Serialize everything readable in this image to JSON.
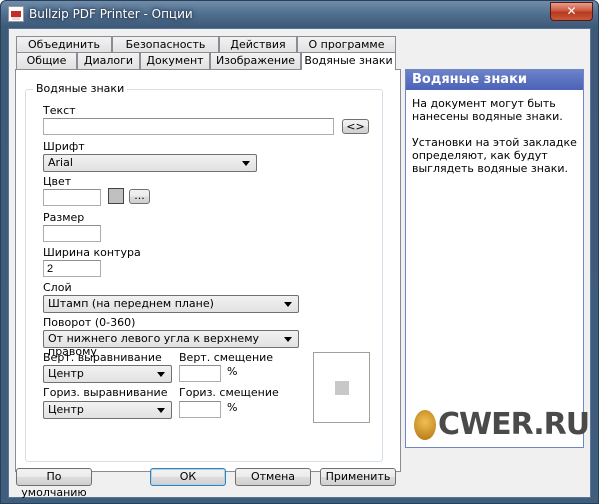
{
  "window": {
    "title": "Bullzip PDF Printer - Опции",
    "close_label": "✕"
  },
  "tabs": {
    "row1": [
      "Объединить",
      "Безопасность",
      "Действия",
      "О программе"
    ],
    "row2": [
      "Общие",
      "Диалоги",
      "Документ",
      "Изображение",
      "Водяные знаки"
    ],
    "active": "Водяные знаки"
  },
  "watermark_group": {
    "title": "Водяные знаки",
    "text_label": "Текст",
    "text_value": "",
    "text_insert_button": "<>",
    "font_label": "Шрифт",
    "font_value": "Arial",
    "color_label": "Цвет",
    "color_value": "",
    "color_browse_button": "...",
    "size_label": "Размер",
    "size_value": "",
    "outline_label": "Ширина контура",
    "outline_value": "2",
    "layer_label": "Слой",
    "layer_value": "Штамп (на переднем плане)",
    "rotation_label": "Поворот (0-360)",
    "rotation_value": "От нижнего левого угла к верхнему правому",
    "valign_label": "Верт. выравнивание",
    "valign_value": "Центр",
    "voffset_label": "Верт. смещение",
    "voffset_value": "",
    "voffset_unit": "%",
    "halign_label": "Гориз. выравнивание",
    "halign_value": "Центр",
    "hoffset_label": "Гориз. смещение",
    "hoffset_value": "",
    "hoffset_unit": "%"
  },
  "help": {
    "title": "Водяные знаки",
    "para1": "На документ могут быть нанесены водяные знаки.",
    "para2": "Установки на этой закладке определяют, как будут выглядеть водяные знаки."
  },
  "watermark_logo": "CWER.RU",
  "buttons": {
    "defaults": "По умолчанию",
    "ok": "ОК",
    "cancel": "Отмена",
    "apply": "Применить"
  }
}
